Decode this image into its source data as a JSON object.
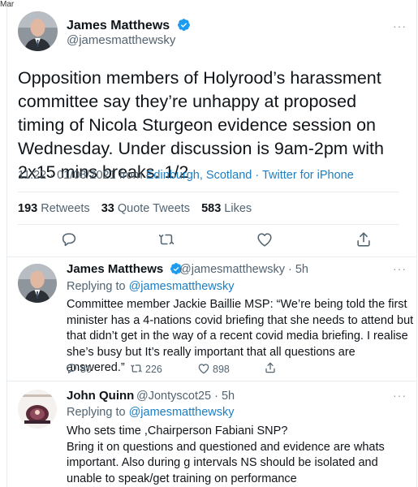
{
  "crop_label": "Mar",
  "main_tweet": {
    "author_name": "James Matthews",
    "author_handle": "@jamesmatthewsky",
    "text": "Opposition members of Holyrood’s harassment committee say they’re unhappy at proposed timing of Nicola Sturgeon evidence session on Wednesday. Under discussion is 9am-2pm with 2x15 mins breaks. 1/2",
    "time": "11:22 · 01/03/2021 from ",
    "location": "Edinburgh, Scotland",
    "separator": " · ",
    "source": "Twitter for iPhone",
    "retweets": "193",
    "retweets_label": "Retweets",
    "quote_tweets": "33",
    "quote_tweets_label": "Quote Tweets",
    "likes": "583",
    "likes_label": "Likes",
    "more": "···"
  },
  "reply1": {
    "author_name": "James Matthews",
    "author_handle": "@jamesmatthewsky · 5h",
    "replying_prefix": "Replying to ",
    "replying_to": "@jamesmatthewsky",
    "text": "Committee member Jackie Baillie MSP: “We’re being told the first minister has a 4-nations covid briefing that she needs to attend but that didn’t get in the way of a recent covid media briefing. I realise she’s busy but It’s really important that all questions are answered.”",
    "replies": "80",
    "retweets": "226",
    "likes": "898",
    "more": "···"
  },
  "reply2": {
    "author_name": "John Quinn",
    "author_handle": "@Jontyscot25 · 5h",
    "replying_prefix": "Replying to ",
    "replying_to": "@jamesmatthewsky",
    "text": "Who sets time ,Chairperson Fabiani SNP?\nBring it on questions and questioned and evidence are whats important.  Also during g intervals NS should be isolated and unable to speak/get training on performance",
    "more": "···"
  },
  "colors": {
    "accent": "#1d9bf0",
    "link": "#1d7ec2",
    "muted": "#536471",
    "divider": "#e6ecf0"
  },
  "icons": [
    "verified-badge-icon",
    "reply-icon",
    "retweet-icon",
    "like-icon",
    "share-icon",
    "more-icon"
  ]
}
